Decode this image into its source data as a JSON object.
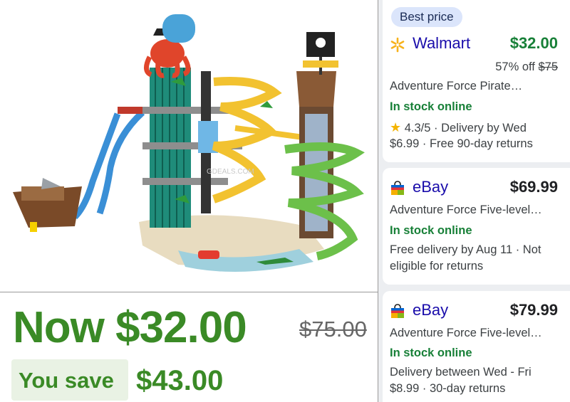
{
  "image": {
    "watermark": "GDEALS.COM"
  },
  "price_panel": {
    "now_price": "Now $32.00",
    "old_price": "$75.00",
    "save_label": "You save",
    "save_amount": "$43.00"
  },
  "colors": {
    "price_green": "#3a8a26",
    "stock_green": "#188038",
    "link_blue": "#1a0dab",
    "badge_bg": "#dbe5fb",
    "star": "#f4b400",
    "panel_bg": "#eceef1"
  },
  "offers": [
    {
      "badge": "Best price",
      "merchant": "Walmart",
      "merchant_icon": "walmart-spark-icon",
      "price": "$32.00",
      "discount_text": "57% off",
      "discount_old": "$75",
      "title": "Adventure Force Pirate…",
      "stock": "In stock online",
      "star_icon": "star-icon",
      "rating": "4.3/5 · Delivery by Wed",
      "shipping": "$6.99 · Free 90-day returns"
    },
    {
      "merchant": "eBay",
      "merchant_icon": "ebay-bag-icon",
      "price": "$69.99",
      "title": "Adventure Force Five-level…",
      "stock": "In stock online",
      "delivery_line1": "Free delivery by Aug 11 · Not",
      "delivery_line2": "eligible for returns"
    },
    {
      "merchant": "eBay",
      "merchant_icon": "ebay-bag-icon",
      "price": "$79.99",
      "title": "Adventure Force Five-level…",
      "stock": "In stock online",
      "delivery_line1": "Delivery between Wed - Fri",
      "delivery_line2": "$8.99 · 30-day returns"
    }
  ]
}
